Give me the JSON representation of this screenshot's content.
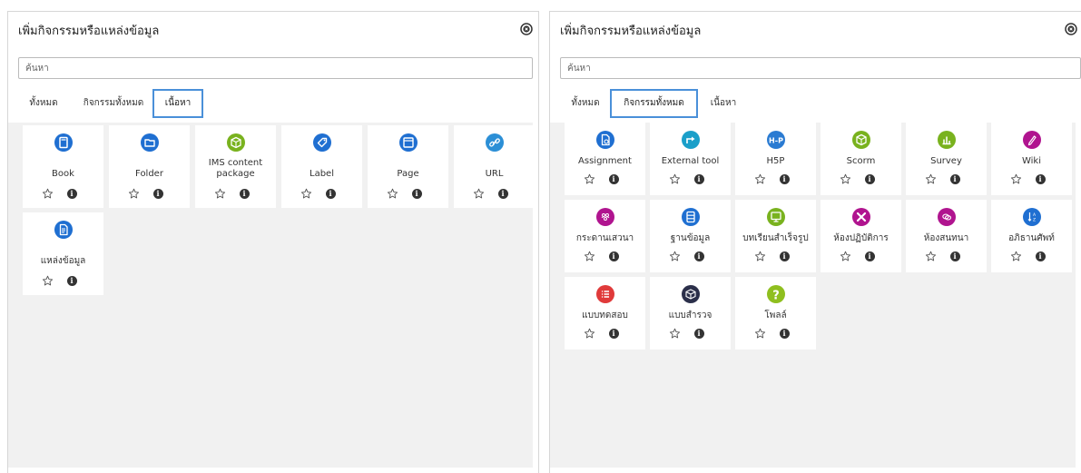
{
  "colors": {
    "tab_highlight": "#4a90d9",
    "grid_bg": "#f1f1f1"
  },
  "left": {
    "title": "เพิ่มกิจกรรมหรือแหล่งข้อมูล",
    "search_placeholder": "ค้นหา",
    "tabs": [
      {
        "label": "ทั้งหมด",
        "active": false
      },
      {
        "label": "กิจกรรมทั้งหมด",
        "active": false
      },
      {
        "label": "เนื้อหา",
        "active": true
      }
    ],
    "items": [
      {
        "name": "Book",
        "icon": "book-icon",
        "color": "#1f6fd1"
      },
      {
        "name": "Folder",
        "icon": "folder-icon",
        "color": "#1f6fd1"
      },
      {
        "name": "IMS content\npackage",
        "icon": "package-icon",
        "color": "#79b21e"
      },
      {
        "name": "Label",
        "icon": "tag-icon",
        "color": "#1f6fd1"
      },
      {
        "name": "Page",
        "icon": "page-icon",
        "color": "#1f6fd1"
      },
      {
        "name": "URL",
        "icon": "link-icon",
        "color": "#2c8fd6"
      },
      {
        "name": "แหล่งข้อมูล",
        "icon": "file-icon",
        "color": "#1f6fd1"
      }
    ]
  },
  "right": {
    "title": "เพิ่มกิจกรรมหรือแหล่งข้อมูล",
    "search_placeholder": "ค้นหา",
    "tabs": [
      {
        "label": "ทั้งหมด",
        "active": false
      },
      {
        "label": "กิจกรรมทั้งหมด",
        "active": true
      },
      {
        "label": "เนื้อหา",
        "active": false
      }
    ],
    "items": [
      {
        "name": "Assignment",
        "icon": "assignment-icon",
        "color": "#1f6fd1"
      },
      {
        "name": "External tool",
        "icon": "external-tool-icon",
        "color": "#1a9fc9"
      },
      {
        "name": "H5P",
        "icon": "h5p-icon",
        "color": "#2a7bd2"
      },
      {
        "name": "Scorm",
        "icon": "package-icon",
        "color": "#79b21e"
      },
      {
        "name": "Survey",
        "icon": "survey-icon",
        "color": "#79b21e"
      },
      {
        "name": "Wiki",
        "icon": "pencil-icon",
        "color": "#b0148f"
      },
      {
        "name": "กระดานเสวนา",
        "icon": "forum-icon",
        "color": "#b0148f"
      },
      {
        "name": "ฐานข้อมูล",
        "icon": "database-icon",
        "color": "#1f6fd1"
      },
      {
        "name": "บทเรียนสำเร็จรูป",
        "icon": "lesson-icon",
        "color": "#79b21e"
      },
      {
        "name": "ห้องปฏิบัติการ",
        "icon": "workshop-icon",
        "color": "#b0148f"
      },
      {
        "name": "ห้องสนทนา",
        "icon": "chat-icon",
        "color": "#b0148f"
      },
      {
        "name": "อภิธานศัพท์",
        "icon": "glossary-icon",
        "color": "#1f6fd1"
      },
      {
        "name": "แบบทดสอบ",
        "icon": "quiz-icon",
        "color": "#e03a3a"
      },
      {
        "name": "แบบสำรวจ",
        "icon": "feedback-icon",
        "color": "#2b2f4a"
      },
      {
        "name": "โพลล์",
        "icon": "question-icon",
        "color": "#8fbf1f"
      }
    ]
  }
}
